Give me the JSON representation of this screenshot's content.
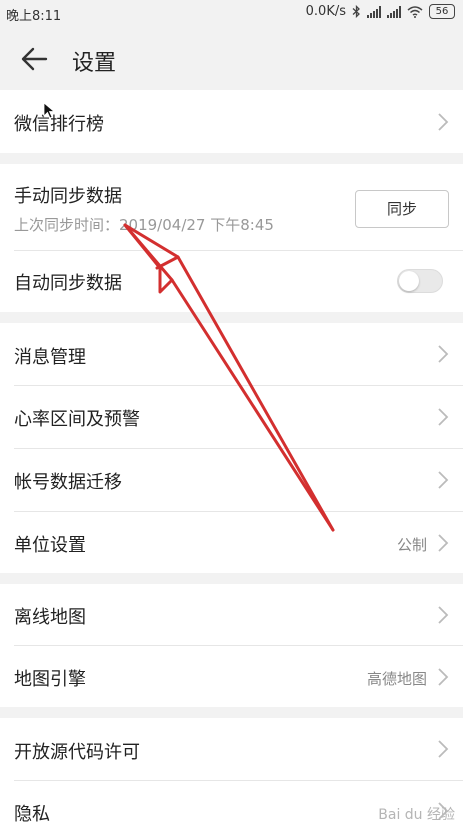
{
  "status_bar": {
    "time": "晚上8:11",
    "network_speed": "0.0K/s",
    "battery": "56",
    "icons": [
      "bluetooth-icon",
      "signal-icon",
      "signal-icon",
      "wifi-icon",
      "battery-icon"
    ]
  },
  "header": {
    "title": "设置",
    "back_icon": "arrow-left-icon"
  },
  "groups": [
    {
      "items": [
        {
          "label": "微信排行榜"
        }
      ]
    },
    {
      "items": [
        {
          "label": "手动同步数据",
          "subtitle": "上次同步时间：2019/04/27 下午8:45",
          "button": "同步"
        },
        {
          "label": "自动同步数据",
          "toggle_on": false
        }
      ]
    },
    {
      "items": [
        {
          "label": "消息管理"
        },
        {
          "label": "心率区间及预警"
        },
        {
          "label": "帐号数据迁移"
        },
        {
          "label": "单位设置",
          "value": "公制"
        }
      ]
    },
    {
      "items": [
        {
          "label": "离线地图"
        },
        {
          "label": "地图引擎",
          "value": "高德地图"
        }
      ]
    },
    {
      "items": [
        {
          "label": "开放源代码许可"
        },
        {
          "label": "隐私"
        }
      ]
    }
  ],
  "watermark": "Bai du 经验",
  "colors": {
    "background": "#f2f2f2",
    "card": "#ffffff",
    "annotation_arrow": "#d32f2f",
    "secondary_text": "#999999"
  }
}
